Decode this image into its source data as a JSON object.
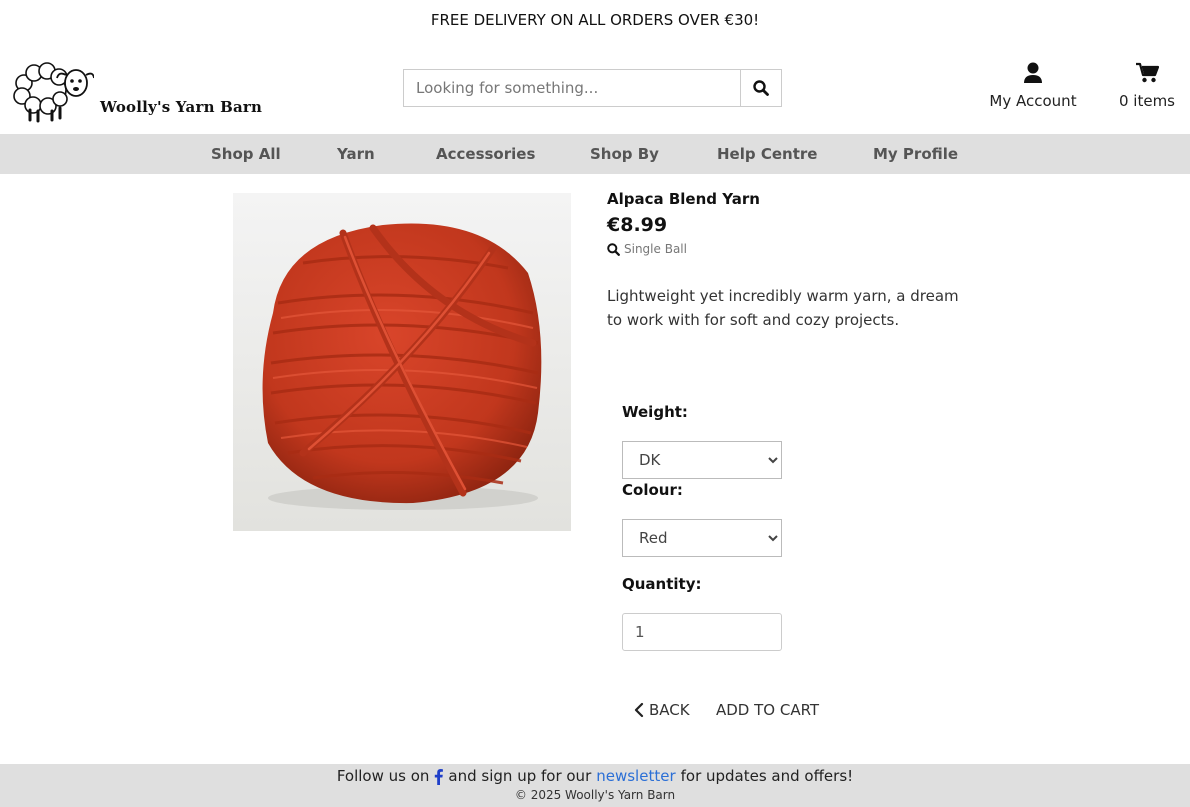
{
  "banner": {
    "text": "FREE DELIVERY ON ALL ORDERS OVER €30!"
  },
  "header": {
    "logo_text": "Woolly's Yarn Barn",
    "search_placeholder": "Looking for something...",
    "account_label": "My Account",
    "cart_label": "0 items"
  },
  "nav": {
    "items": [
      "Shop All",
      "Yarn",
      "Accessories",
      "Shop By",
      "Help Centre",
      "My Profile"
    ]
  },
  "product": {
    "name": "Alpaca Blend Yarn",
    "price": "€8.99",
    "size": "Single Ball",
    "description": "Lightweight yet incredibly warm yarn, a dream to work with for soft and cozy projects.",
    "image_color": "#c9391f"
  },
  "form": {
    "weight_label": "Weight:",
    "weight_value": "DK",
    "colour_label": "Colour:",
    "colour_value": "Red",
    "quantity_label": "Quantity:",
    "quantity_value": "1",
    "back_label": "BACK",
    "add_to_cart_label": "ADD TO CART"
  },
  "footer": {
    "follow_prefix": "Follow us on",
    "follow_middle": "and sign up for our",
    "newsletter_link": "newsletter",
    "follow_suffix": "for updates and offers!",
    "copyright": "© 2025 Woolly's Yarn Barn"
  }
}
